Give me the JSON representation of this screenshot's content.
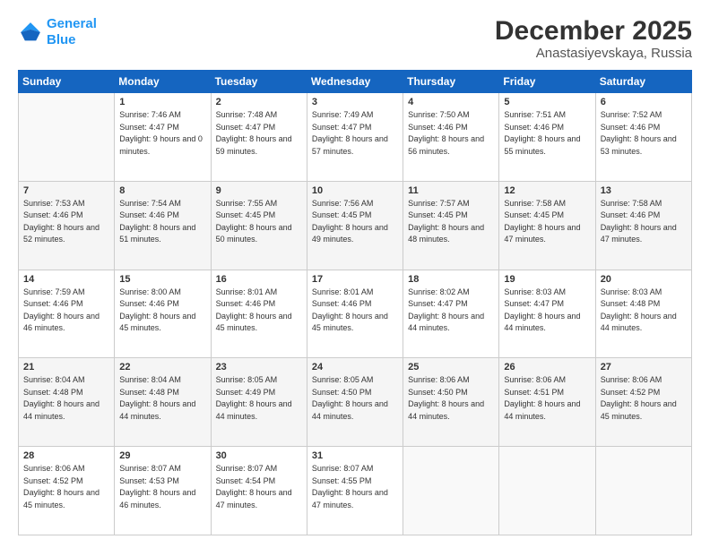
{
  "logo": {
    "line1": "General",
    "line2": "Blue"
  },
  "header": {
    "month": "December 2025",
    "location": "Anastasiyevskaya, Russia"
  },
  "weekdays": [
    "Sunday",
    "Monday",
    "Tuesday",
    "Wednesday",
    "Thursday",
    "Friday",
    "Saturday"
  ],
  "weeks": [
    [
      {
        "day": "",
        "sunrise": "",
        "sunset": "",
        "daylight": ""
      },
      {
        "day": "1",
        "sunrise": "Sunrise: 7:46 AM",
        "sunset": "Sunset: 4:47 PM",
        "daylight": "Daylight: 9 hours and 0 minutes."
      },
      {
        "day": "2",
        "sunrise": "Sunrise: 7:48 AM",
        "sunset": "Sunset: 4:47 PM",
        "daylight": "Daylight: 8 hours and 59 minutes."
      },
      {
        "day": "3",
        "sunrise": "Sunrise: 7:49 AM",
        "sunset": "Sunset: 4:47 PM",
        "daylight": "Daylight: 8 hours and 57 minutes."
      },
      {
        "day": "4",
        "sunrise": "Sunrise: 7:50 AM",
        "sunset": "Sunset: 4:46 PM",
        "daylight": "Daylight: 8 hours and 56 minutes."
      },
      {
        "day": "5",
        "sunrise": "Sunrise: 7:51 AM",
        "sunset": "Sunset: 4:46 PM",
        "daylight": "Daylight: 8 hours and 55 minutes."
      },
      {
        "day": "6",
        "sunrise": "Sunrise: 7:52 AM",
        "sunset": "Sunset: 4:46 PM",
        "daylight": "Daylight: 8 hours and 53 minutes."
      }
    ],
    [
      {
        "day": "7",
        "sunrise": "Sunrise: 7:53 AM",
        "sunset": "Sunset: 4:46 PM",
        "daylight": "Daylight: 8 hours and 52 minutes."
      },
      {
        "day": "8",
        "sunrise": "Sunrise: 7:54 AM",
        "sunset": "Sunset: 4:46 PM",
        "daylight": "Daylight: 8 hours and 51 minutes."
      },
      {
        "day": "9",
        "sunrise": "Sunrise: 7:55 AM",
        "sunset": "Sunset: 4:45 PM",
        "daylight": "Daylight: 8 hours and 50 minutes."
      },
      {
        "day": "10",
        "sunrise": "Sunrise: 7:56 AM",
        "sunset": "Sunset: 4:45 PM",
        "daylight": "Daylight: 8 hours and 49 minutes."
      },
      {
        "day": "11",
        "sunrise": "Sunrise: 7:57 AM",
        "sunset": "Sunset: 4:45 PM",
        "daylight": "Daylight: 8 hours and 48 minutes."
      },
      {
        "day": "12",
        "sunrise": "Sunrise: 7:58 AM",
        "sunset": "Sunset: 4:45 PM",
        "daylight": "Daylight: 8 hours and 47 minutes."
      },
      {
        "day": "13",
        "sunrise": "Sunrise: 7:58 AM",
        "sunset": "Sunset: 4:46 PM",
        "daylight": "Daylight: 8 hours and 47 minutes."
      }
    ],
    [
      {
        "day": "14",
        "sunrise": "Sunrise: 7:59 AM",
        "sunset": "Sunset: 4:46 PM",
        "daylight": "Daylight: 8 hours and 46 minutes."
      },
      {
        "day": "15",
        "sunrise": "Sunrise: 8:00 AM",
        "sunset": "Sunset: 4:46 PM",
        "daylight": "Daylight: 8 hours and 45 minutes."
      },
      {
        "day": "16",
        "sunrise": "Sunrise: 8:01 AM",
        "sunset": "Sunset: 4:46 PM",
        "daylight": "Daylight: 8 hours and 45 minutes."
      },
      {
        "day": "17",
        "sunrise": "Sunrise: 8:01 AM",
        "sunset": "Sunset: 4:46 PM",
        "daylight": "Daylight: 8 hours and 45 minutes."
      },
      {
        "day": "18",
        "sunrise": "Sunrise: 8:02 AM",
        "sunset": "Sunset: 4:47 PM",
        "daylight": "Daylight: 8 hours and 44 minutes."
      },
      {
        "day": "19",
        "sunrise": "Sunrise: 8:03 AM",
        "sunset": "Sunset: 4:47 PM",
        "daylight": "Daylight: 8 hours and 44 minutes."
      },
      {
        "day": "20",
        "sunrise": "Sunrise: 8:03 AM",
        "sunset": "Sunset: 4:48 PM",
        "daylight": "Daylight: 8 hours and 44 minutes."
      }
    ],
    [
      {
        "day": "21",
        "sunrise": "Sunrise: 8:04 AM",
        "sunset": "Sunset: 4:48 PM",
        "daylight": "Daylight: 8 hours and 44 minutes."
      },
      {
        "day": "22",
        "sunrise": "Sunrise: 8:04 AM",
        "sunset": "Sunset: 4:48 PM",
        "daylight": "Daylight: 8 hours and 44 minutes."
      },
      {
        "day": "23",
        "sunrise": "Sunrise: 8:05 AM",
        "sunset": "Sunset: 4:49 PM",
        "daylight": "Daylight: 8 hours and 44 minutes."
      },
      {
        "day": "24",
        "sunrise": "Sunrise: 8:05 AM",
        "sunset": "Sunset: 4:50 PM",
        "daylight": "Daylight: 8 hours and 44 minutes."
      },
      {
        "day": "25",
        "sunrise": "Sunrise: 8:06 AM",
        "sunset": "Sunset: 4:50 PM",
        "daylight": "Daylight: 8 hours and 44 minutes."
      },
      {
        "day": "26",
        "sunrise": "Sunrise: 8:06 AM",
        "sunset": "Sunset: 4:51 PM",
        "daylight": "Daylight: 8 hours and 44 minutes."
      },
      {
        "day": "27",
        "sunrise": "Sunrise: 8:06 AM",
        "sunset": "Sunset: 4:52 PM",
        "daylight": "Daylight: 8 hours and 45 minutes."
      }
    ],
    [
      {
        "day": "28",
        "sunrise": "Sunrise: 8:06 AM",
        "sunset": "Sunset: 4:52 PM",
        "daylight": "Daylight: 8 hours and 45 minutes."
      },
      {
        "day": "29",
        "sunrise": "Sunrise: 8:07 AM",
        "sunset": "Sunset: 4:53 PM",
        "daylight": "Daylight: 8 hours and 46 minutes."
      },
      {
        "day": "30",
        "sunrise": "Sunrise: 8:07 AM",
        "sunset": "Sunset: 4:54 PM",
        "daylight": "Daylight: 8 hours and 47 minutes."
      },
      {
        "day": "31",
        "sunrise": "Sunrise: 8:07 AM",
        "sunset": "Sunset: 4:55 PM",
        "daylight": "Daylight: 8 hours and 47 minutes."
      },
      {
        "day": "",
        "sunrise": "",
        "sunset": "",
        "daylight": ""
      },
      {
        "day": "",
        "sunrise": "",
        "sunset": "",
        "daylight": ""
      },
      {
        "day": "",
        "sunrise": "",
        "sunset": "",
        "daylight": ""
      }
    ]
  ]
}
